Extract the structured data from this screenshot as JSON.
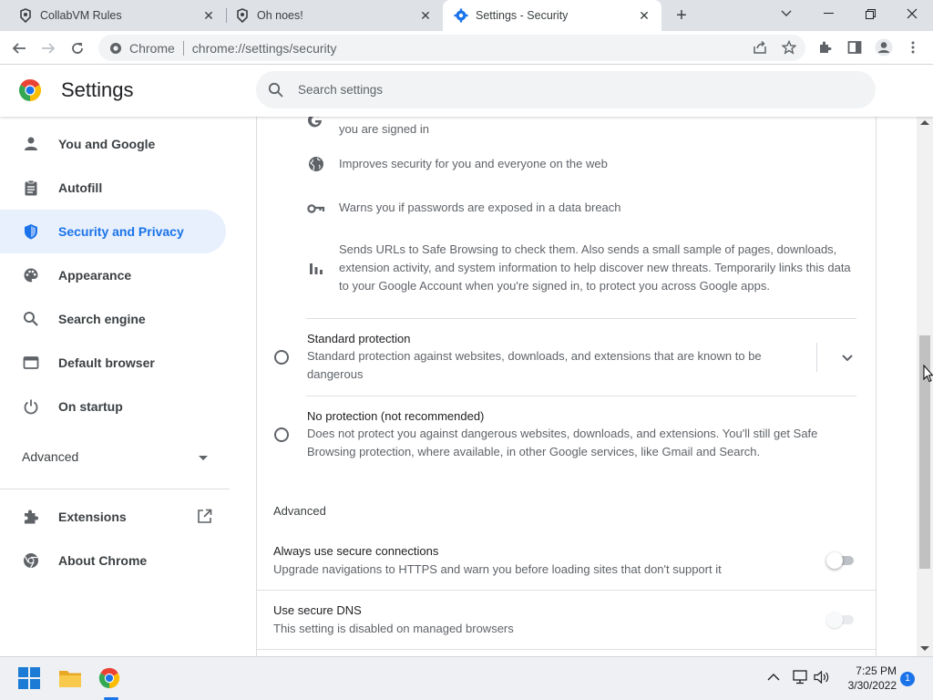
{
  "tabs": [
    {
      "title": "CollabVM Rules",
      "icon": "collabvm-icon",
      "active": false
    },
    {
      "title": "Oh noes!",
      "icon": "collabvm-icon",
      "active": false
    },
    {
      "title": "Settings - Security",
      "icon": "settings-gear-icon",
      "active": true
    }
  ],
  "new_tab_label": "+",
  "window_controls": {
    "dropdown": "⌄",
    "minimize": "—",
    "restore": "❐",
    "close": "✕"
  },
  "toolbar": {
    "site_label": "Chrome",
    "url": "chrome://settings/security"
  },
  "settings": {
    "title": "Settings",
    "search_placeholder": "Search settings"
  },
  "sidebar": {
    "items": [
      {
        "label": "You and Google",
        "icon": "person-icon"
      },
      {
        "label": "Autofill",
        "icon": "clipboard-icon"
      },
      {
        "label": "Security and Privacy",
        "icon": "shield-icon",
        "active": true
      },
      {
        "label": "Appearance",
        "icon": "palette-icon"
      },
      {
        "label": "Search engine",
        "icon": "search-icon"
      },
      {
        "label": "Default browser",
        "icon": "browser-icon"
      },
      {
        "label": "On startup",
        "icon": "power-icon"
      }
    ],
    "advanced_label": "Advanced",
    "extensions_label": "Extensions",
    "about_label": "About Chrome"
  },
  "main": {
    "features": [
      {
        "icon": "google-g-icon",
        "text_lines": [
          "you are signed in"
        ]
      },
      {
        "icon": "globe-icon",
        "text_lines": [
          "Improves security for you and everyone on the web"
        ]
      },
      {
        "icon": "key-icon",
        "text_lines": [
          "Warns you if passwords are exposed in a data breach"
        ]
      },
      {
        "icon": "bar-chart-icon",
        "text_lines": [
          "Sends URLs to Safe Browsing to check them. Also sends a small sample of pages, downloads,",
          "extension activity, and system information to help discover new threats. Temporarily links this data",
          "to your Google Account when you're signed in, to protect you across Google apps."
        ]
      }
    ],
    "standard": {
      "title": "Standard protection",
      "desc": "Standard protection against websites, downloads, and extensions that are known to be dangerous"
    },
    "none": {
      "title": "No protection (not recommended)",
      "desc": "Does not protect you against dangerous websites, downloads, and extensions. You'll still get Safe Browsing protection, where available, in other Google services, like Gmail and Search."
    },
    "advanced_heading": "Advanced",
    "secure_connections": {
      "title": "Always use secure connections",
      "desc": "Upgrade navigations to HTTPS and warn you before loading sites that don't support it",
      "enabled": false
    },
    "secure_dns": {
      "title": "Use secure DNS",
      "desc": "This setting is disabled on managed browsers",
      "enabled": false,
      "disabled": true
    }
  },
  "taskbar": {
    "time": "7:25 PM",
    "date": "3/30/2022",
    "notification_count": "1"
  },
  "colors": {
    "accent": "#1a73e8",
    "active_bg": "#e8f0fe"
  }
}
